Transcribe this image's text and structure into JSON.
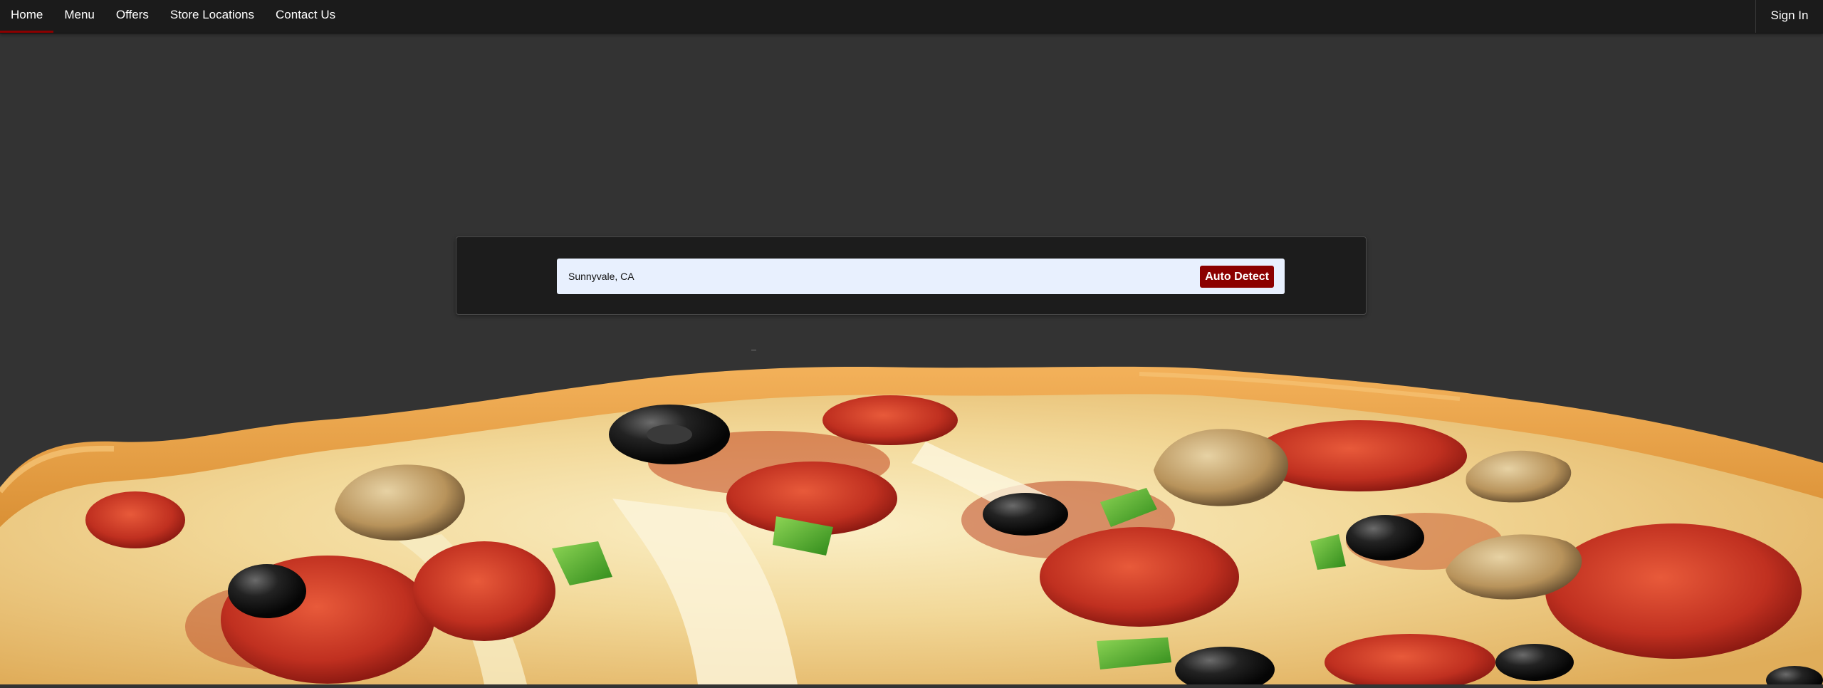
{
  "nav": {
    "items": [
      {
        "label": "Home",
        "active": true
      },
      {
        "label": "Menu",
        "active": false
      },
      {
        "label": "Offers",
        "active": false
      },
      {
        "label": "Store Locations",
        "active": false
      },
      {
        "label": "Contact Us",
        "active": false
      }
    ],
    "signin_label": "Sign In"
  },
  "search": {
    "location_value": "Sunnyvale, CA",
    "auto_detect_label": "Auto Detect"
  },
  "hero": {
    "image": "pizza-photo"
  },
  "colors": {
    "background": "#333333",
    "navbar": "#1b1b1b",
    "accent": "#8b0000",
    "input_bg": "#e8f0fe"
  }
}
